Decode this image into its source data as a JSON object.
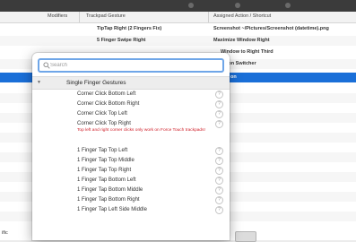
{
  "table": {
    "headers": [
      "Modifiers",
      "Trackpad Gesture",
      "Assigned Action / Shortcut"
    ],
    "rows": [
      {
        "gesture": "TipTap Right (2 Fingers Fix)",
        "action": "Screenshot ~/Pictures/Screenshot (datetime).png"
      },
      {
        "gesture": "5 Finger Swipe Right",
        "action": "Maximize Window Right"
      },
      {
        "gesture": "",
        "action": "Window to Right Third"
      },
      {
        "gesture": "",
        "action": "ation Switcher"
      },
      {
        "gesture": "",
        "action": "on"
      }
    ],
    "bottom_left_label": "ific"
  },
  "popover": {
    "search_placeholder": "Search",
    "section_title": "Single Finger Gestures",
    "items": [
      "Corner Click Bottom Left",
      "Corner Click Bottom Right",
      "Corner Click Top Left",
      "Corner Click Top Right",
      "1 Finger Tap Top Left",
      "1 Finger Tap Top Middle",
      "1 Finger Tap Top Right",
      "1 Finger Tap Bottom Left",
      "1 Finger Tap Bottom Middle",
      "1 Finger Tap Bottom Right",
      "1 Finger Tap Left Side Middle"
    ],
    "note": "Top left and right corner clicks only work on Force Touch trackpads!",
    "help_glyph": "?"
  },
  "colors": {
    "selection": "#1a6fd8",
    "search_focus": "#6fa6e8",
    "warning": "#d0202a"
  }
}
